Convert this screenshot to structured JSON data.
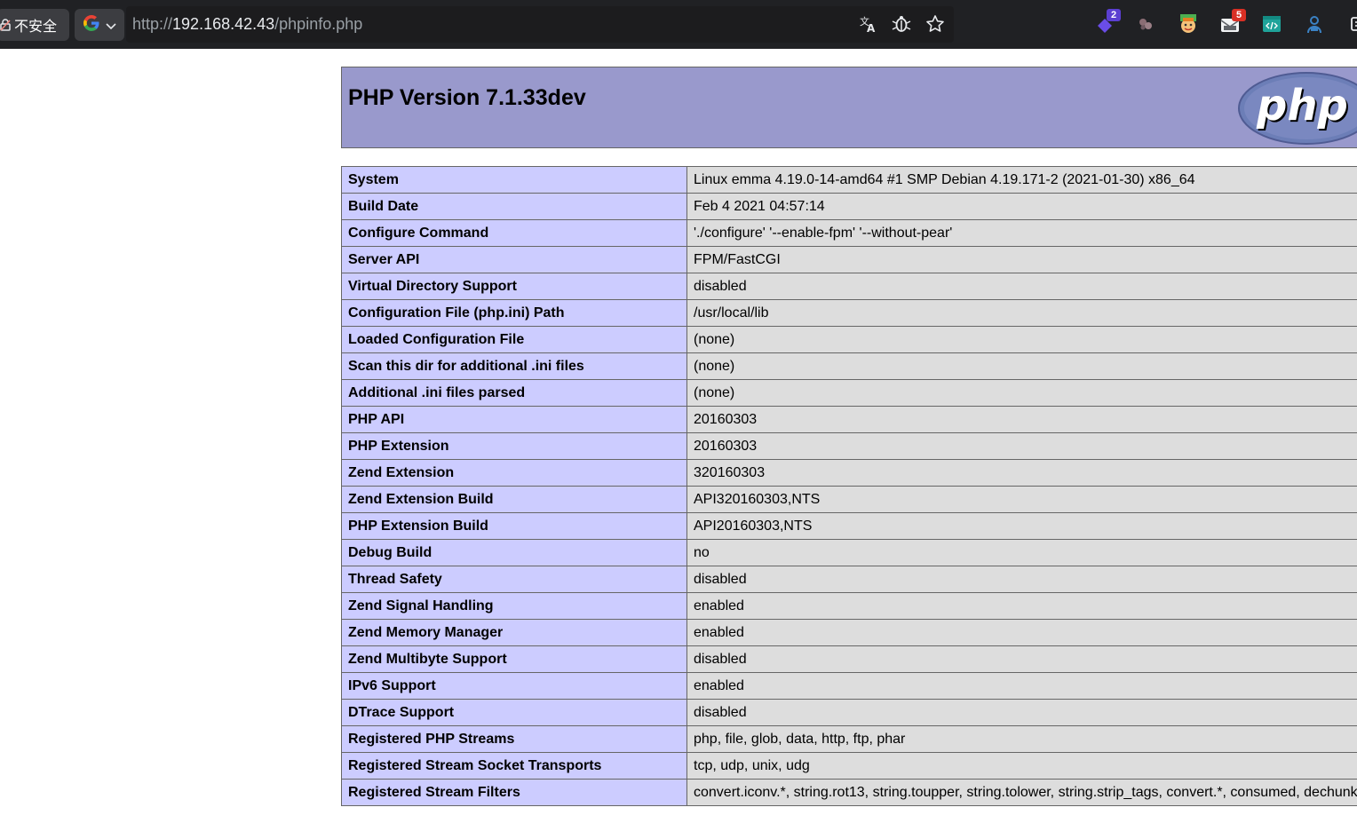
{
  "browser": {
    "security_label": "不安全",
    "url_scheme": "http://",
    "url_host": "192.168.42.43",
    "url_path": "/phpinfo.php",
    "extensions": [
      {
        "name": "extension-purple",
        "badge": "2",
        "badge_color": "#5b3fd1"
      },
      {
        "name": "extension-gray"
      },
      {
        "name": "extension-character"
      },
      {
        "name": "extension-mail",
        "badge": "5",
        "badge_color": "#d93025"
      },
      {
        "name": "extension-code"
      },
      {
        "name": "extension-person"
      }
    ]
  },
  "phpinfo": {
    "version_title": "PHP Version 7.1.33dev",
    "logo_text": "php",
    "rows": [
      {
        "label": "System",
        "value": "Linux emma 4.19.0-14-amd64 #1 SMP Debian 4.19.171-2 (2021-01-30) x86_64"
      },
      {
        "label": "Build Date",
        "value": "Feb 4 2021 04:57:14"
      },
      {
        "label": "Configure Command",
        "value": "'./configure' '--enable-fpm' '--without-pear'"
      },
      {
        "label": "Server API",
        "value": "FPM/FastCGI"
      },
      {
        "label": "Virtual Directory Support",
        "value": "disabled"
      },
      {
        "label": "Configuration File (php.ini) Path",
        "value": "/usr/local/lib"
      },
      {
        "label": "Loaded Configuration File",
        "value": "(none)"
      },
      {
        "label": "Scan this dir for additional .ini files",
        "value": "(none)"
      },
      {
        "label": "Additional .ini files parsed",
        "value": "(none)"
      },
      {
        "label": "PHP API",
        "value": "20160303"
      },
      {
        "label": "PHP Extension",
        "value": "20160303"
      },
      {
        "label": "Zend Extension",
        "value": "320160303"
      },
      {
        "label": "Zend Extension Build",
        "value": "API320160303,NTS"
      },
      {
        "label": "PHP Extension Build",
        "value": "API20160303,NTS"
      },
      {
        "label": "Debug Build",
        "value": "no"
      },
      {
        "label": "Thread Safety",
        "value": "disabled"
      },
      {
        "label": "Zend Signal Handling",
        "value": "enabled"
      },
      {
        "label": "Zend Memory Manager",
        "value": "enabled"
      },
      {
        "label": "Zend Multibyte Support",
        "value": "disabled"
      },
      {
        "label": "IPv6 Support",
        "value": "enabled"
      },
      {
        "label": "DTrace Support",
        "value": "disabled"
      },
      {
        "label": "Registered PHP Streams",
        "value": "php, file, glob, data, http, ftp, phar"
      },
      {
        "label": "Registered Stream Socket Transports",
        "value": "tcp, udp, unix, udg"
      },
      {
        "label": "Registered Stream Filters",
        "value": "convert.iconv.*, string.rot13, string.toupper, string.tolower, string.strip_tags, convert.*, consumed, dechunk"
      }
    ]
  },
  "colors": {
    "header_bg": "#9999cc",
    "label_bg": "#ccccff",
    "value_bg": "#dddddd",
    "chrome_bg": "#202124"
  }
}
